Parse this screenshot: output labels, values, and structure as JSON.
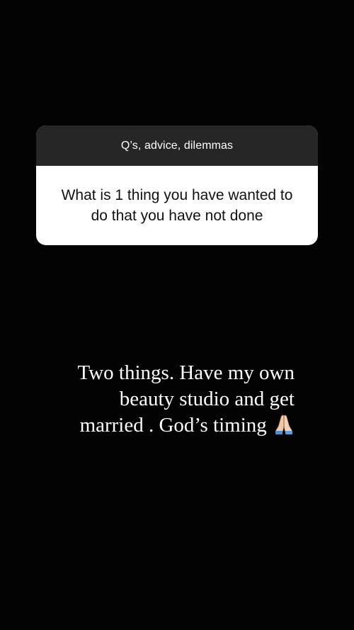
{
  "story": {
    "question_sticker": {
      "prompt": "Q’s, advice, dilemmas",
      "question": "What is 1 thing you have wanted to do that you have not done"
    },
    "answer": {
      "lines": [
        "Two things. Have my own",
        "beauty studio and get",
        "married . God’s timing"
      ],
      "emoji": "folded-hands-icon"
    }
  },
  "colors": {
    "background": "#030303",
    "sticker_header": "#262626",
    "sticker_body": "#ffffff",
    "answer_text": "#ffffff"
  }
}
